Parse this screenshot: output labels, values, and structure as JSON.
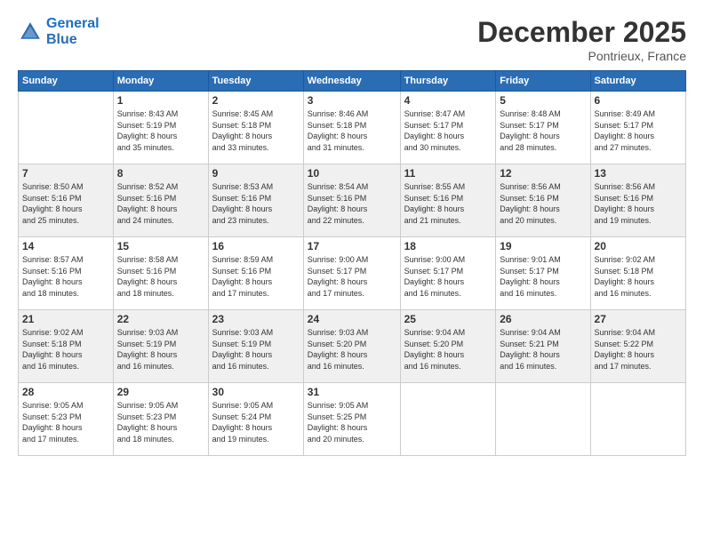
{
  "header": {
    "logo_line1": "General",
    "logo_line2": "Blue",
    "month": "December 2025",
    "location": "Pontrieux, France"
  },
  "days_of_week": [
    "Sunday",
    "Monday",
    "Tuesday",
    "Wednesday",
    "Thursday",
    "Friday",
    "Saturday"
  ],
  "weeks": [
    [
      {
        "day": "",
        "info": ""
      },
      {
        "day": "1",
        "info": "Sunrise: 8:43 AM\nSunset: 5:19 PM\nDaylight: 8 hours\nand 35 minutes."
      },
      {
        "day": "2",
        "info": "Sunrise: 8:45 AM\nSunset: 5:18 PM\nDaylight: 8 hours\nand 33 minutes."
      },
      {
        "day": "3",
        "info": "Sunrise: 8:46 AM\nSunset: 5:18 PM\nDaylight: 8 hours\nand 31 minutes."
      },
      {
        "day": "4",
        "info": "Sunrise: 8:47 AM\nSunset: 5:17 PM\nDaylight: 8 hours\nand 30 minutes."
      },
      {
        "day": "5",
        "info": "Sunrise: 8:48 AM\nSunset: 5:17 PM\nDaylight: 8 hours\nand 28 minutes."
      },
      {
        "day": "6",
        "info": "Sunrise: 8:49 AM\nSunset: 5:17 PM\nDaylight: 8 hours\nand 27 minutes."
      }
    ],
    [
      {
        "day": "7",
        "info": "Sunrise: 8:50 AM\nSunset: 5:16 PM\nDaylight: 8 hours\nand 25 minutes."
      },
      {
        "day": "8",
        "info": "Sunrise: 8:52 AM\nSunset: 5:16 PM\nDaylight: 8 hours\nand 24 minutes."
      },
      {
        "day": "9",
        "info": "Sunrise: 8:53 AM\nSunset: 5:16 PM\nDaylight: 8 hours\nand 23 minutes."
      },
      {
        "day": "10",
        "info": "Sunrise: 8:54 AM\nSunset: 5:16 PM\nDaylight: 8 hours\nand 22 minutes."
      },
      {
        "day": "11",
        "info": "Sunrise: 8:55 AM\nSunset: 5:16 PM\nDaylight: 8 hours\nand 21 minutes."
      },
      {
        "day": "12",
        "info": "Sunrise: 8:56 AM\nSunset: 5:16 PM\nDaylight: 8 hours\nand 20 minutes."
      },
      {
        "day": "13",
        "info": "Sunrise: 8:56 AM\nSunset: 5:16 PM\nDaylight: 8 hours\nand 19 minutes."
      }
    ],
    [
      {
        "day": "14",
        "info": "Sunrise: 8:57 AM\nSunset: 5:16 PM\nDaylight: 8 hours\nand 18 minutes."
      },
      {
        "day": "15",
        "info": "Sunrise: 8:58 AM\nSunset: 5:16 PM\nDaylight: 8 hours\nand 18 minutes."
      },
      {
        "day": "16",
        "info": "Sunrise: 8:59 AM\nSunset: 5:16 PM\nDaylight: 8 hours\nand 17 minutes."
      },
      {
        "day": "17",
        "info": "Sunrise: 9:00 AM\nSunset: 5:17 PM\nDaylight: 8 hours\nand 17 minutes."
      },
      {
        "day": "18",
        "info": "Sunrise: 9:00 AM\nSunset: 5:17 PM\nDaylight: 8 hours\nand 16 minutes."
      },
      {
        "day": "19",
        "info": "Sunrise: 9:01 AM\nSunset: 5:17 PM\nDaylight: 8 hours\nand 16 minutes."
      },
      {
        "day": "20",
        "info": "Sunrise: 9:02 AM\nSunset: 5:18 PM\nDaylight: 8 hours\nand 16 minutes."
      }
    ],
    [
      {
        "day": "21",
        "info": "Sunrise: 9:02 AM\nSunset: 5:18 PM\nDaylight: 8 hours\nand 16 minutes."
      },
      {
        "day": "22",
        "info": "Sunrise: 9:03 AM\nSunset: 5:19 PM\nDaylight: 8 hours\nand 16 minutes."
      },
      {
        "day": "23",
        "info": "Sunrise: 9:03 AM\nSunset: 5:19 PM\nDaylight: 8 hours\nand 16 minutes."
      },
      {
        "day": "24",
        "info": "Sunrise: 9:03 AM\nSunset: 5:20 PM\nDaylight: 8 hours\nand 16 minutes."
      },
      {
        "day": "25",
        "info": "Sunrise: 9:04 AM\nSunset: 5:20 PM\nDaylight: 8 hours\nand 16 minutes."
      },
      {
        "day": "26",
        "info": "Sunrise: 9:04 AM\nSunset: 5:21 PM\nDaylight: 8 hours\nand 16 minutes."
      },
      {
        "day": "27",
        "info": "Sunrise: 9:04 AM\nSunset: 5:22 PM\nDaylight: 8 hours\nand 17 minutes."
      }
    ],
    [
      {
        "day": "28",
        "info": "Sunrise: 9:05 AM\nSunset: 5:23 PM\nDaylight: 8 hours\nand 17 minutes."
      },
      {
        "day": "29",
        "info": "Sunrise: 9:05 AM\nSunset: 5:23 PM\nDaylight: 8 hours\nand 18 minutes."
      },
      {
        "day": "30",
        "info": "Sunrise: 9:05 AM\nSunset: 5:24 PM\nDaylight: 8 hours\nand 19 minutes."
      },
      {
        "day": "31",
        "info": "Sunrise: 9:05 AM\nSunset: 5:25 PM\nDaylight: 8 hours\nand 20 minutes."
      },
      {
        "day": "",
        "info": ""
      },
      {
        "day": "",
        "info": ""
      },
      {
        "day": "",
        "info": ""
      }
    ]
  ]
}
